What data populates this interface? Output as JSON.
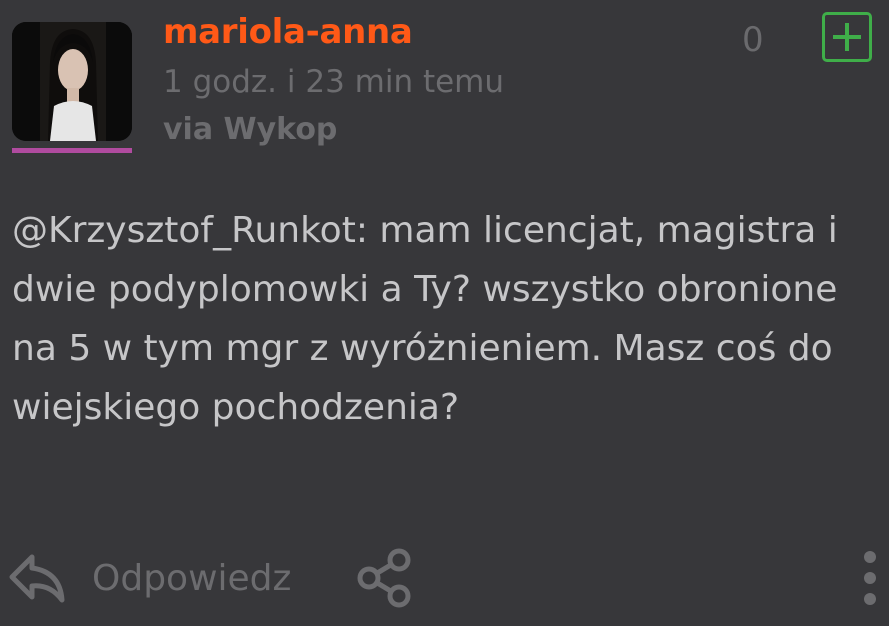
{
  "entry": {
    "author": "mariola-anna",
    "timestamp": "1 godz. i 23 min temu",
    "source": "via Wykop",
    "votes": "0",
    "mention": "@Krzysztof_Runkot",
    "body": ": mam licencjat, magistra i dwie podyplomowki a Ty? wszystko obronione na 5 w tym mgr z wyróżnieniem. Masz coś do wiejskiego pochodzenia?"
  },
  "actions": {
    "reply_label": "Odpowiedz"
  },
  "colors": {
    "background": "#37373a",
    "username": "#ff5917",
    "plus_accent": "#3fae49",
    "avatar_accent": "#b04b9f",
    "text_primary": "#c6c6c8",
    "text_muted": "#6c6c6f"
  },
  "icons": {
    "avatar": "user-avatar-photo",
    "plus": "plus-icon",
    "reply": "reply-arrow-icon",
    "share": "share-icon",
    "more": "more-vertical-icon"
  }
}
